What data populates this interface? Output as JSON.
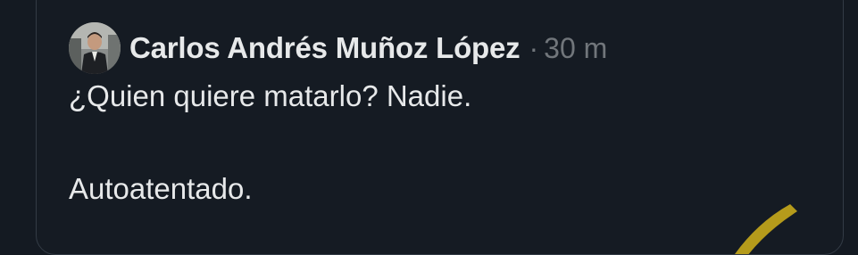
{
  "post": {
    "author_name": "Carlos Andrés Muñoz López",
    "separator": "·",
    "timestamp": "30 m",
    "text_lines": [
      "¿Quien quiere matarlo? Nadie.",
      "Autoatentado."
    ]
  },
  "icons": {
    "avatar": "profile-photo"
  },
  "colors": {
    "background": "#151b23",
    "border": "#333b45",
    "text_primary": "#e7e9ea",
    "text_secondary": "#71767b",
    "watermark_accent": "#e5c21a"
  }
}
